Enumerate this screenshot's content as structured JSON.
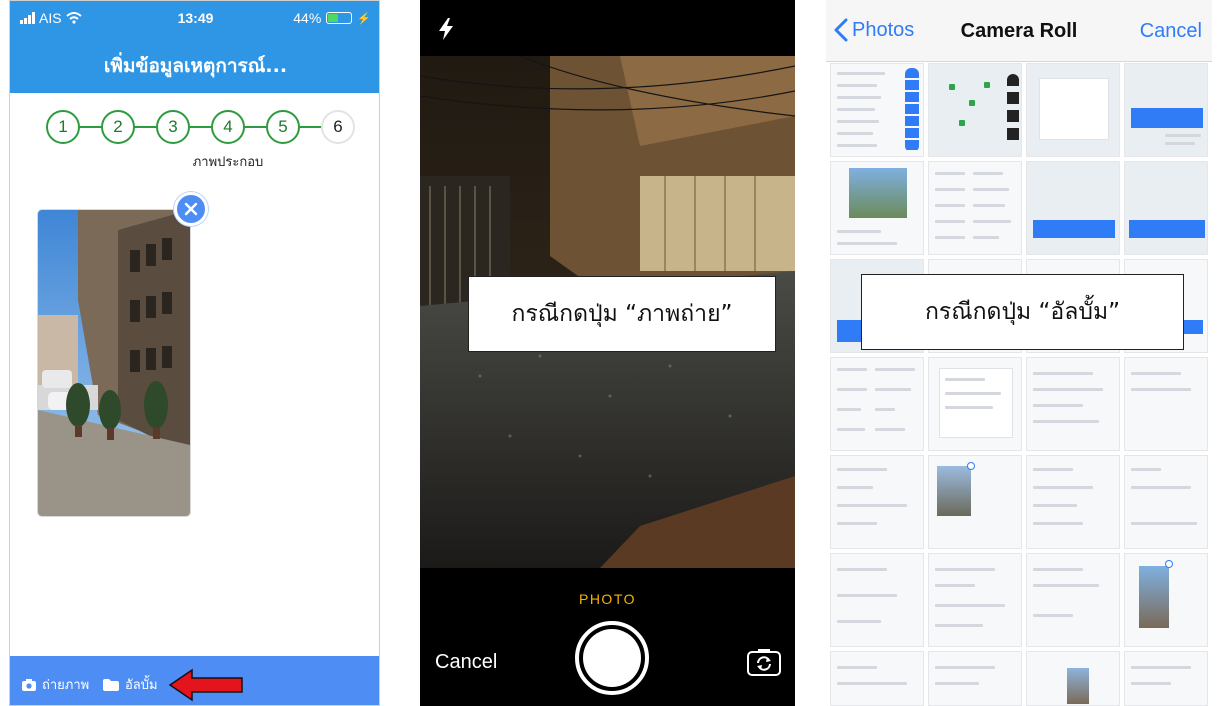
{
  "screen1": {
    "status": {
      "carrier": "AIS",
      "time": "13:49",
      "battery": "44%",
      "battery_level": 0.44
    },
    "title": "เพิ่มข้อมูลเหตุการณ์...",
    "steps": [
      "1",
      "2",
      "3",
      "4",
      "5",
      "6"
    ],
    "current_step": 6,
    "step_caption": "ภาพประกอบ",
    "bottom_bar": {
      "camera_label": "ถ่ายภาพ",
      "album_label": "อัลบั้ม"
    },
    "colors": {
      "header": "#2f96e6",
      "bottom_bar": "#4e8ef4",
      "step_border": "#2e9b3f",
      "arrow": "#e3141b"
    }
  },
  "screen2": {
    "caption": "กรณีกดปุ่ม “ภาพถ่าย”",
    "mode_label": "PHOTO",
    "cancel_label": "Cancel",
    "icons": {
      "flash": "flash-icon",
      "flip": "flip-camera-icon"
    }
  },
  "screen3": {
    "back_label": "Photos",
    "title": "Camera Roll",
    "cancel_label": "Cancel",
    "caption": "กรณีกดปุ่ม “อัลบั้ม”"
  }
}
